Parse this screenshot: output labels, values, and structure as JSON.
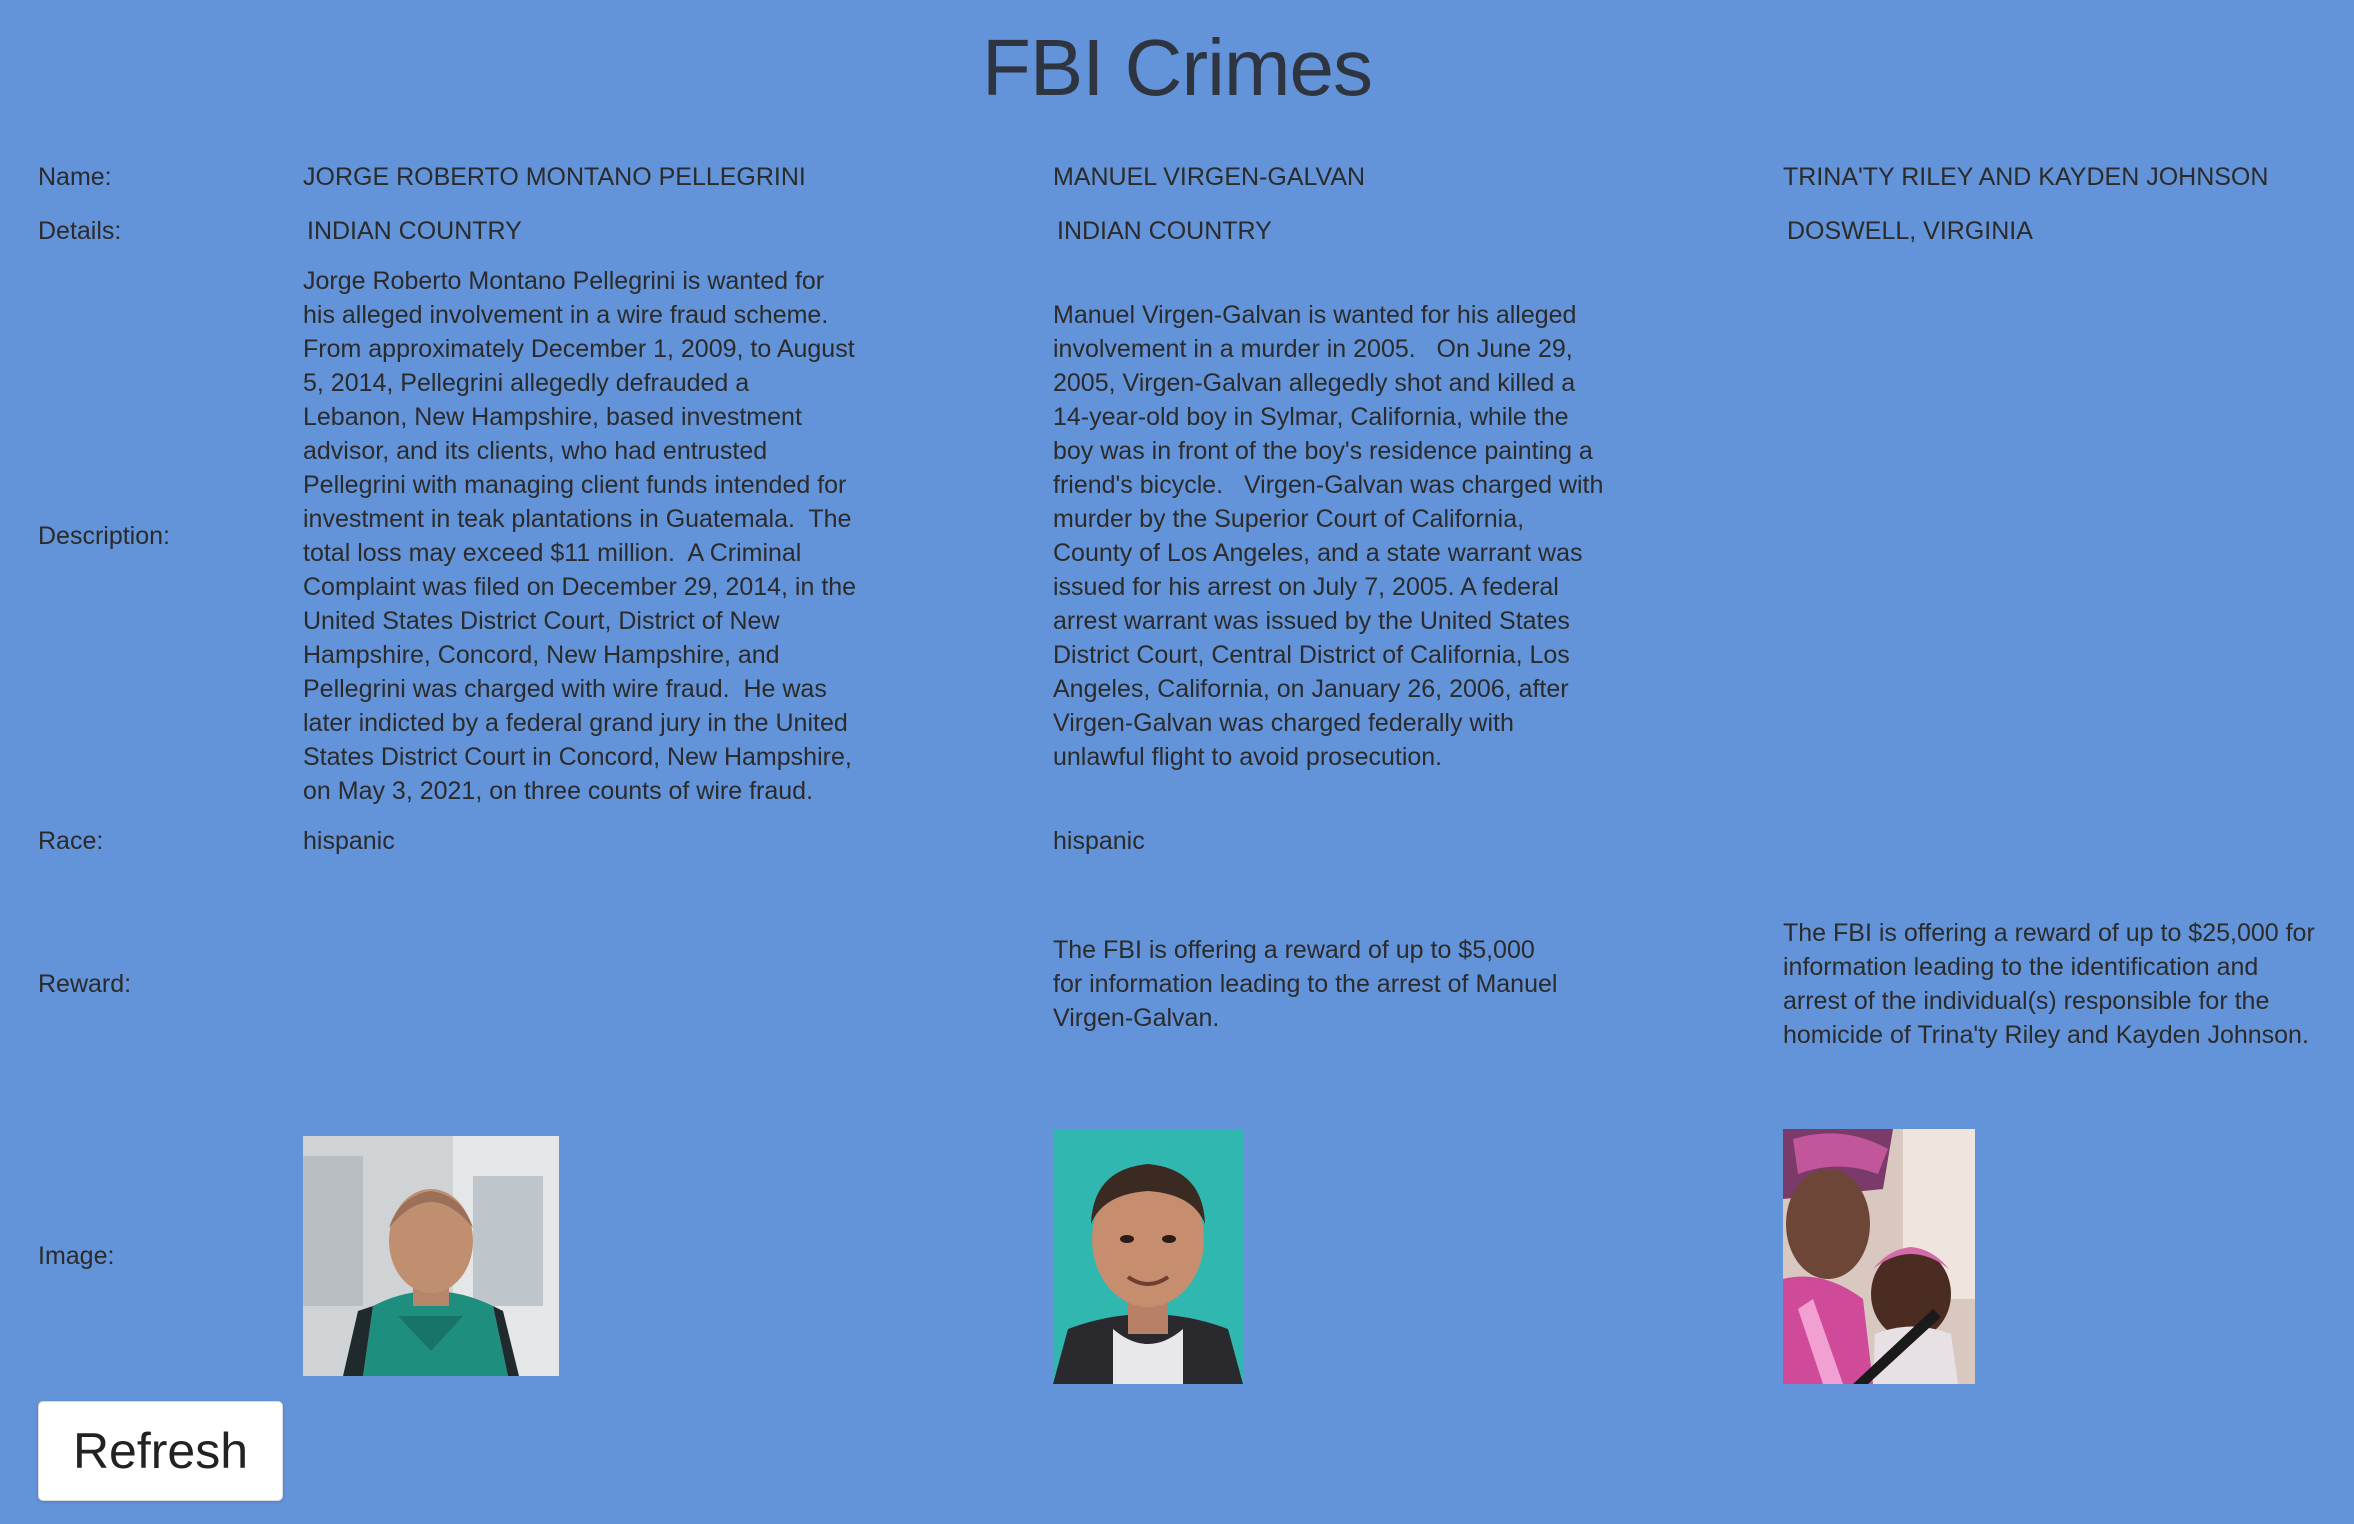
{
  "page": {
    "title": "FBI Crimes"
  },
  "labels": {
    "name": "Name:",
    "details": "Details:",
    "description": "Description:",
    "race": "Race:",
    "reward": "Reward:",
    "image": "Image:"
  },
  "records": [
    {
      "name": "JORGE ROBERTO MONTANO PELLEGRINI",
      "details": "INDIAN COUNTRY",
      "description": "Jorge Roberto Montano Pellegrini is wanted for his alleged involvement in a wire fraud scheme.  From approximately December 1, 2009, to August 5, 2014, Pellegrini allegedly defrauded a Lebanon, New Hampshire, based investment advisor, and its clients, who had entrusted Pellegrini with managing client funds intended for investment in teak plantations in Guatemala.  The total loss may exceed $11 million.  A Criminal Complaint was filed on December 29, 2014, in the United States District Court, District of New Hampshire, Concord, New Hampshire, and Pellegrini was charged with wire fraud.  He was later indicted by a federal grand jury in the United States District Court in Concord, New Hampshire, on May 3, 2021, on three counts of wire fraud.",
      "race": "hispanic",
      "reward": "",
      "image_desc": "photo-man-green-shirt"
    },
    {
      "name": "MANUEL VIRGEN-GALVAN",
      "details": "INDIAN COUNTRY",
      "description": "Manuel Virgen-Galvan is wanted for his alleged involvement in a murder in 2005.   On June 29, 2005, Virgen-Galvan allegedly shot and killed a 14-year-old boy in Sylmar, California, while the boy was in front of the boy's residence painting a friend's bicycle.   Virgen-Galvan was charged with murder by the Superior Court of California, County of Los Angeles, and a state warrant was issued for his arrest on July 7, 2005. A federal arrest warrant was issued by the United States District Court, Central District of California, Los Angeles, California, on January 26, 2006, after Virgen-Galvan was charged federally with unlawful flight to avoid prosecution.",
      "race": "hispanic",
      "reward": "The FBI is offering a reward of up to $5,000 for information leading to the arrest of Manuel Virgen-Galvan.",
      "image_desc": "photo-id-portrait"
    },
    {
      "name": "TRINA'TY RILEY AND KAYDEN JOHNSON",
      "details": "DOSWELL, VIRGINIA",
      "description": "",
      "race": "",
      "reward": "The FBI is offering a reward of up to $25,000 for information leading to the identification and arrest of the individual(s) responsible for the homicide of Trina'ty Riley and Kayden Johnson.",
      "image_desc": "photo-woman-and-child"
    }
  ],
  "actions": {
    "refresh_label": "Refresh"
  },
  "colors": {
    "background": "#6393d8",
    "text": "#2b2b2b",
    "button_bg": "#ffffff"
  }
}
